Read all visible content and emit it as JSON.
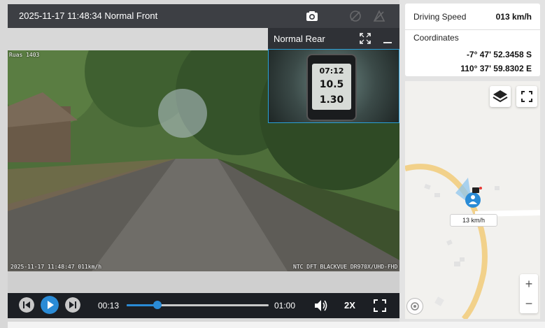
{
  "player": {
    "front_title": "2025-11-17 11:48:34 Normal Front",
    "rear_title": "Normal Rear",
    "osd_top_left": "Ruas 1403",
    "osd_bottom_left": "2025-11-17 11:48:47 011km/h",
    "osd_bottom_right": "NTC DFT BLACKVUE DR970X/UHD-FHD",
    "rear_gauge": {
      "time": "07:12",
      "distance": "10.5",
      "speed": "1.30"
    },
    "current_time": "00:13",
    "total_time": "01:00",
    "progress_fraction": 0.217,
    "speed_mult": "2X"
  },
  "info": {
    "speed_label": "Driving Speed",
    "speed_value": "013 km/h",
    "coords_label": "Coordinates",
    "lat": "-7° 47' 52.3458 S",
    "lon": "110° 37' 59.8302 E"
  },
  "map": {
    "speed_badge": "13 km/h",
    "zoom_in": "+",
    "zoom_out": "−"
  },
  "colors": {
    "accent": "#2a8bd6",
    "road": "#f2d18a",
    "dark": "#1c1f24"
  }
}
